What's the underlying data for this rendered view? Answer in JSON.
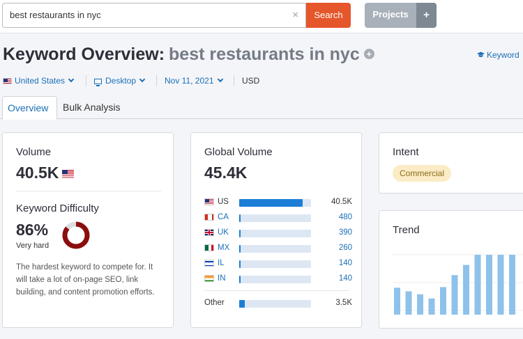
{
  "search": {
    "value": "best restaurants in nyc",
    "clear_glyph": "×",
    "button": "Search"
  },
  "projects": {
    "label": "Projects",
    "add_glyph": "+"
  },
  "header": {
    "title": "Keyword Overview:",
    "keyword": "best restaurants in nyc",
    "plus_glyph": "+",
    "link": "Keyword"
  },
  "filters": {
    "country": "United States",
    "device": "Desktop",
    "date": "Nov 11, 2021",
    "currency": "USD"
  },
  "tabs": [
    {
      "label": "Overview"
    },
    {
      "label": "Bulk Analysis"
    }
  ],
  "volume": {
    "title": "Volume",
    "value": "40.5K"
  },
  "difficulty": {
    "title": "Keyword Difficulty",
    "value": "86%",
    "percent": 86,
    "level": "Very hard",
    "description": "The hardest keyword to compete for. It will take a lot of on-page SEO, link building, and content promotion efforts."
  },
  "global_volume": {
    "title": "Global Volume",
    "value": "45.4K",
    "countries": [
      {
        "code": "US",
        "value": "40.5K",
        "fraction": 0.88,
        "flag": "us-flag"
      },
      {
        "code": "CA",
        "value": "480",
        "fraction": 0.02,
        "flag": "ca-flag"
      },
      {
        "code": "UK",
        "value": "390",
        "fraction": 0.02,
        "flag": "uk-flag"
      },
      {
        "code": "MX",
        "value": "260",
        "fraction": 0.02,
        "flag": "mx-flag"
      },
      {
        "code": "IL",
        "value": "140",
        "fraction": 0.02,
        "flag": "il-flag"
      },
      {
        "code": "IN",
        "value": "140",
        "fraction": 0.02,
        "flag": "in-flag"
      }
    ],
    "other": {
      "label": "Other",
      "value": "3.5K",
      "fraction": 0.08
    }
  },
  "intent": {
    "title": "Intent",
    "badge": "Commercial"
  },
  "trend": {
    "title": "Trend",
    "values": [
      0.45,
      0.39,
      0.34,
      0.27,
      0.46,
      0.66,
      0.83,
      1.0,
      1.0,
      1.0,
      1.0
    ]
  },
  "colors": {
    "accent": "#e5562a",
    "link": "#1a6fb5",
    "bar": "#1c7ed6",
    "trend_bar": "#8fc2ea",
    "difficulty": "#8b0e0e"
  }
}
